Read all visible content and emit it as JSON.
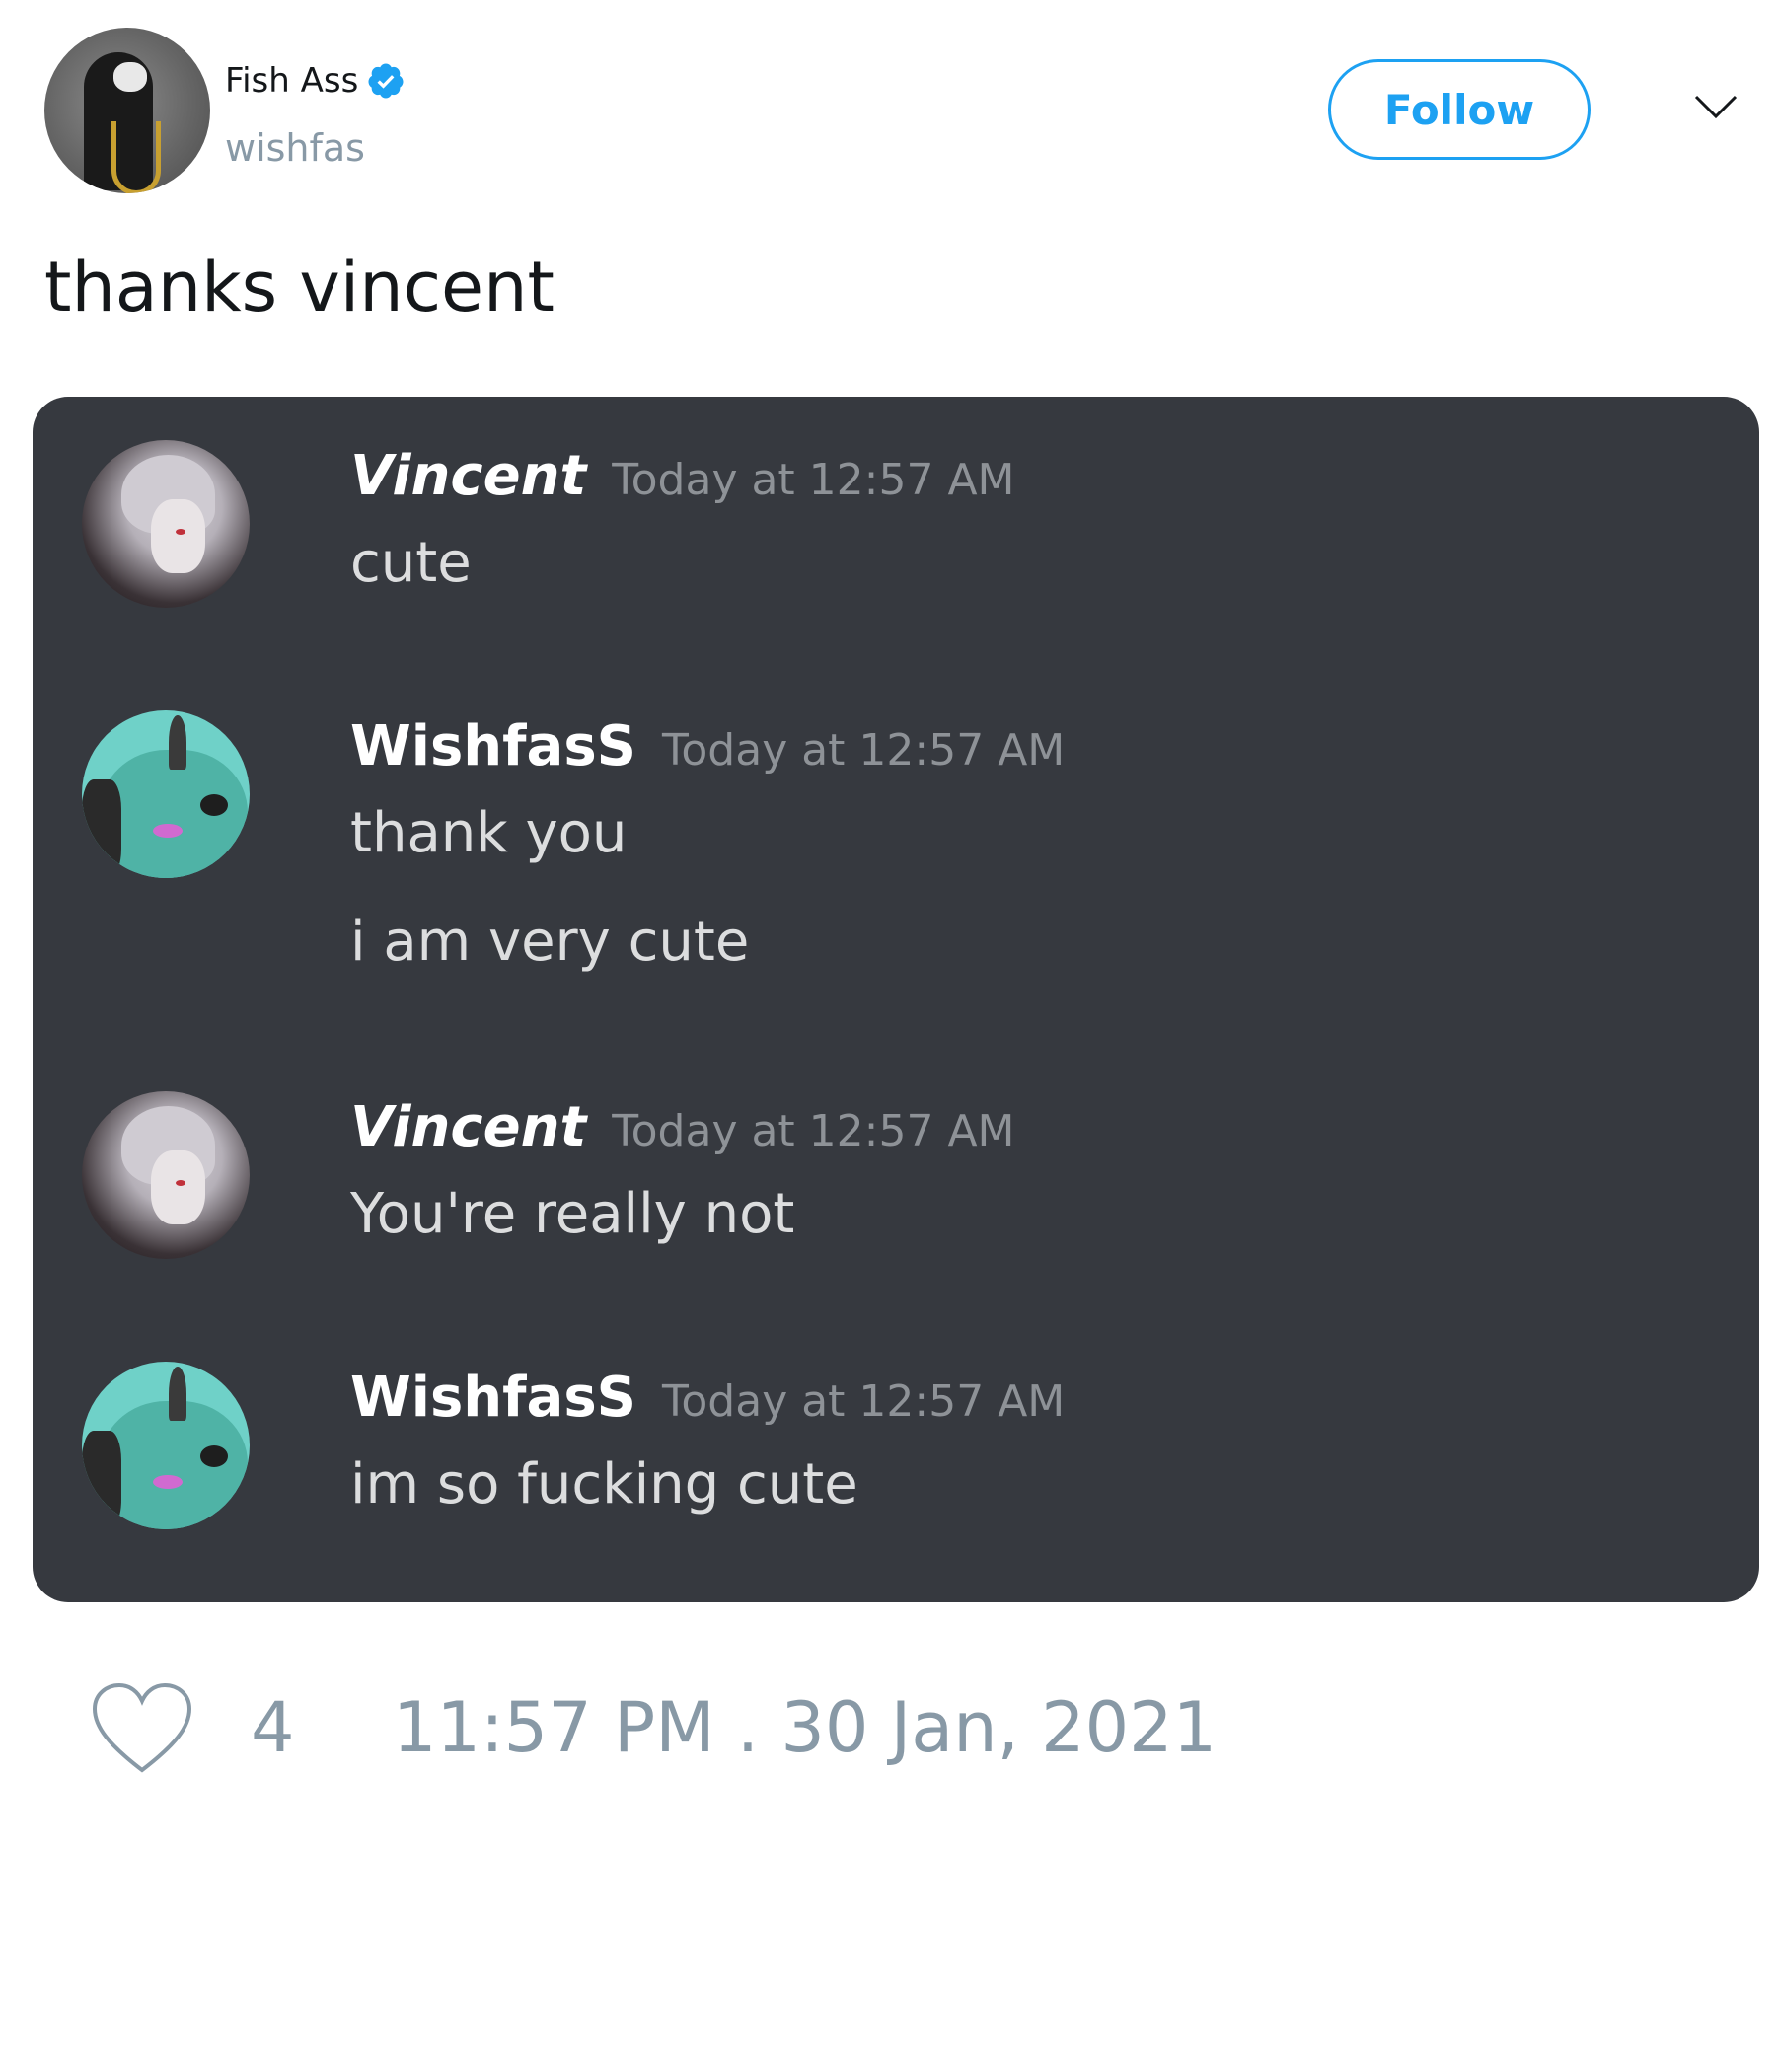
{
  "header": {
    "display_name": "Fish Ass",
    "handle": "wishfas",
    "follow_label": "Follow"
  },
  "tweet": {
    "text": "thanks vincent"
  },
  "discord": {
    "messages": [
      {
        "author": "Vincent",
        "timestamp": "Today at 12:57 AM",
        "lines": [
          "cute"
        ]
      },
      {
        "author": "WishfasS",
        "timestamp": "Today at 12:57 AM",
        "lines": [
          "thank you",
          "i am very cute"
        ]
      },
      {
        "author": "Vincent",
        "timestamp": "Today at 12:57 AM",
        "lines": [
          "You're really not"
        ]
      },
      {
        "author": "WishfasS",
        "timestamp": "Today at 12:57 AM",
        "lines": [
          "im so fucking cute"
        ]
      }
    ]
  },
  "footer": {
    "likes": "4",
    "datetime": "11:57 PM . 30 Jan, 2021"
  },
  "colors": {
    "accent": "#1da1f2",
    "muted": "#8899a6",
    "discord_bg": "#36393f",
    "discord_text": "#dcddde",
    "discord_timestamp": "#8e9297"
  },
  "icons": {
    "verified": "verified-badge-icon",
    "more": "chevron-down-icon",
    "like": "heart-icon"
  }
}
